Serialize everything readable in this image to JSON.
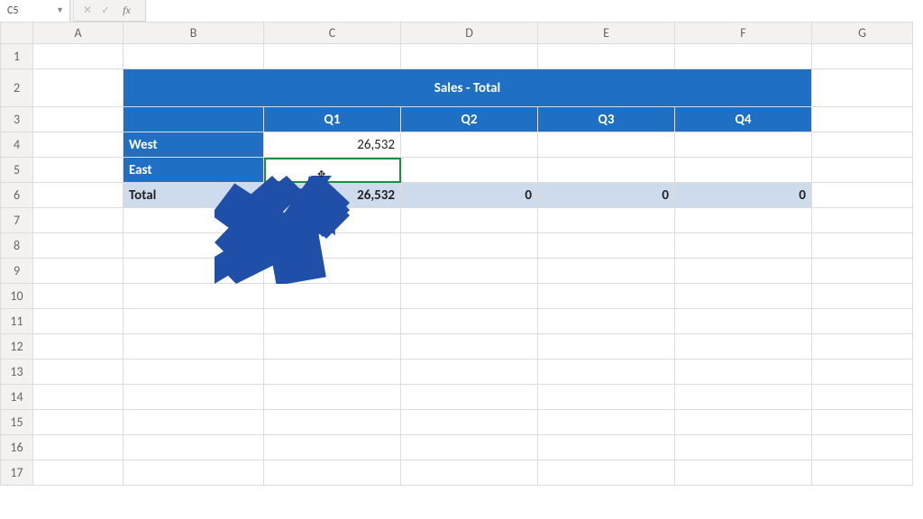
{
  "formula_bar": {
    "name_box": "C5",
    "cancel_glyph": "✕",
    "enter_glyph": "✓",
    "fx_label": "fx",
    "formula": ""
  },
  "col_headers": [
    "A",
    "B",
    "C",
    "D",
    "E",
    "F",
    "G"
  ],
  "row_headers": [
    "1",
    "2",
    "3",
    "4",
    "5",
    "6",
    "7",
    "8",
    "9",
    "10",
    "11",
    "12",
    "13",
    "14",
    "15",
    "16",
    "17"
  ],
  "active_cell": {
    "col": "C",
    "row": "5"
  },
  "sales_table": {
    "title": "Sales - Total",
    "columns": [
      "Q1",
      "Q2",
      "Q3",
      "Q4"
    ],
    "rows": [
      {
        "label": "West",
        "values": [
          "26,532",
          "",
          "",
          ""
        ]
      },
      {
        "label": "East",
        "values": [
          "",
          "",
          "",
          ""
        ]
      }
    ],
    "total_label": "Total",
    "totals": [
      "26,532",
      "0",
      "0",
      "0"
    ]
  }
}
